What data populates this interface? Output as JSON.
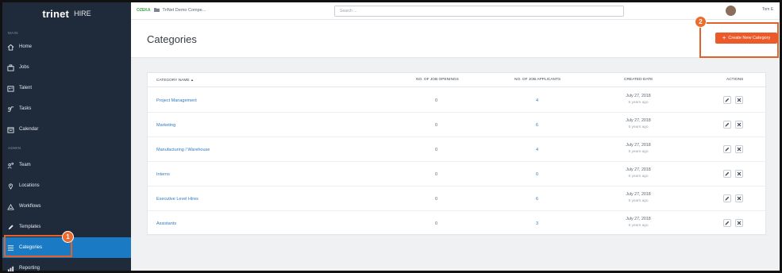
{
  "app": {
    "brand": "trinet",
    "product": "HIRE"
  },
  "sidebar": {
    "section_main": "MAIN",
    "section_admin": "ADMIN",
    "items": [
      {
        "label": "Home",
        "icon": "home-icon"
      },
      {
        "label": "Jobs",
        "icon": "briefcase-icon"
      },
      {
        "label": "Talent",
        "icon": "id-card-icon"
      },
      {
        "label": "Tasks",
        "icon": "tasks-icon"
      },
      {
        "label": "Calendar",
        "icon": "calendar-icon"
      },
      {
        "label": "Team",
        "icon": "team-icon"
      },
      {
        "label": "Locations",
        "icon": "location-pin-icon"
      },
      {
        "label": "Workflows",
        "icon": "workflow-icon"
      },
      {
        "label": "Templates",
        "icon": "pencil-icon"
      },
      {
        "label": "Categories",
        "icon": "list-icon"
      },
      {
        "label": "Reporting",
        "icon": "chart-icon"
      }
    ]
  },
  "topbar": {
    "company_logo": "OZEKA",
    "company_name": "TriNet Demo Compe...",
    "search_placeholder": "Search ...",
    "user": "Tom E"
  },
  "header": {
    "title": "Categories",
    "create_button": "Create New Category"
  },
  "table": {
    "columns": [
      "CATEGORY NAME",
      "NO. OF JOB OPENINGS",
      "NO. OF JOB APPLICANTS",
      "CREATED DATE",
      "ACTIONS"
    ],
    "sort_indicator": "▲",
    "rows": [
      {
        "name": "Project Management",
        "openings": "0",
        "applicants": "4",
        "date": "July 27, 2018",
        "ago": "5 years ago"
      },
      {
        "name": "Marketing",
        "openings": "0",
        "applicants": "6",
        "date": "July 27, 2018",
        "ago": "5 years ago"
      },
      {
        "name": "Manufacturing / Warehouse",
        "openings": "0",
        "applicants": "4",
        "date": "July 27, 2018",
        "ago": "5 years ago"
      },
      {
        "name": "Interns",
        "openings": "0",
        "applicants": "0",
        "date": "July 27, 2018",
        "ago": "5 years ago"
      },
      {
        "name": "Executive Level Hires",
        "openings": "0",
        "applicants": "6",
        "date": "July 27, 2018",
        "ago": "5 years ago"
      },
      {
        "name": "Assistants",
        "openings": "0",
        "applicants": "3",
        "date": "July 27, 2018",
        "ago": "5 years ago"
      }
    ]
  },
  "annotations": {
    "step1": "1",
    "step2": "2"
  },
  "colors": {
    "sidebar_bg": "#1f2a3a",
    "active": "#1a7bc4",
    "accent": "#ec5a2a",
    "link": "#2f7ac0"
  }
}
